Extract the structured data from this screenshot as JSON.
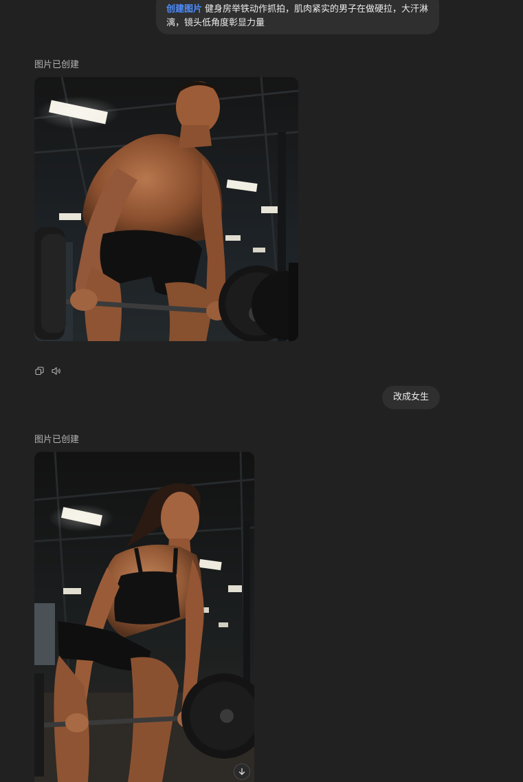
{
  "conversation": {
    "prompt1": {
      "tag": "创建图片",
      "text": "健身房举铁动作抓拍，肌肉紧实的男子在做硬拉，大汗淋漓，镜头低角度彰显力量"
    },
    "status1": "图片已创建",
    "prompt2": "改成女生",
    "status2": "图片已创建"
  },
  "icons": {
    "copy": "copy-icon",
    "speaker": "speaker-icon",
    "scroll": "arrow-down-icon"
  },
  "colors": {
    "background": "#212121",
    "bubble": "#2f2f2f",
    "tag": "#4c8dff",
    "muted": "#b4b4b4"
  }
}
